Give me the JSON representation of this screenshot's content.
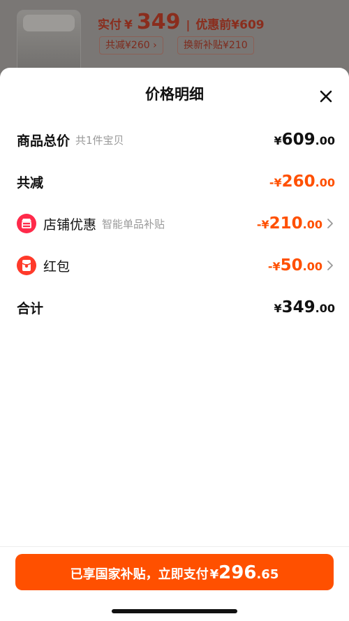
{
  "background": {
    "price_label": "实付",
    "price_currency": "¥",
    "price_value": "349",
    "separator": "|",
    "original_label": "优惠前¥609",
    "chip_discount": "共减¥260 ›",
    "chip_tradein": "换新补贴¥210"
  },
  "sheet": {
    "title": "价格明细",
    "close_icon": "close-icon"
  },
  "rows": {
    "total": {
      "label": "商品总价",
      "sub": "共1件宝贝",
      "yen": "¥",
      "int": "609",
      "dec": ".00"
    },
    "reduce": {
      "label": "共减",
      "yen": "-¥",
      "int": "260",
      "dec": ".00"
    },
    "store": {
      "label": "店铺优惠",
      "sub": "智能单品补贴",
      "yen": "-¥",
      "int": "210",
      "dec": ".00",
      "icon": "store-icon"
    },
    "redpacket": {
      "label": "红包",
      "yen": "-¥",
      "int": "50",
      "dec": ".00",
      "icon": "red-packet-icon"
    },
    "sum": {
      "label": "合计",
      "yen": "¥",
      "int": "349",
      "dec": ".00"
    }
  },
  "pay_button": {
    "text": "已享国家补贴，立即支付",
    "yen": "¥",
    "int": "296",
    "dec": ".65"
  },
  "colors": {
    "accent": "#ff5000",
    "store_badge": "#ff2a4a",
    "red_packet_badge": "#ff3a2a"
  }
}
